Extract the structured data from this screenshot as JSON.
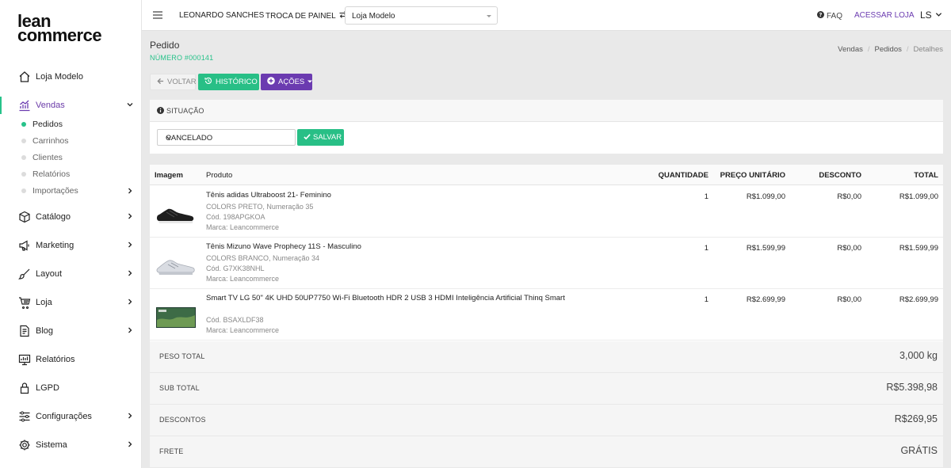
{
  "brand": {
    "logo_line1": "lean",
    "logo_line2": "commerce",
    "accent_green": "#27c28a",
    "accent_purple": "#6b3bb0"
  },
  "topbar": {
    "user_name": "LEONARDO SANCHES",
    "switch_panel": "TROCA DE PAINEL",
    "store": "Loja Modelo",
    "faq": "FAQ",
    "access_store": "ACESSAR LOJA",
    "avatar_initials": "LS"
  },
  "sidebar": {
    "items": [
      {
        "label": "Loja Modelo",
        "icon": "house-icon"
      },
      {
        "label": "Vendas",
        "icon": "chart-icon"
      },
      {
        "label": "Catálogo",
        "icon": "box-icon"
      },
      {
        "label": "Marketing",
        "icon": "megaphone-icon"
      },
      {
        "label": "Layout",
        "icon": "brush-icon"
      },
      {
        "label": "Loja",
        "icon": "cart-icon"
      },
      {
        "label": "Blog",
        "icon": "document-icon"
      },
      {
        "label": "Relatórios",
        "icon": "monitor-chart-icon"
      },
      {
        "label": "LGPD",
        "icon": "lock-icon"
      },
      {
        "label": "Configurações",
        "icon": "sliders-icon"
      },
      {
        "label": "Sistema",
        "icon": "gear-icon"
      }
    ],
    "sales_sub": [
      "Pedidos",
      "Carrinhos",
      "Clientes",
      "Relatórios",
      "Importações"
    ]
  },
  "page": {
    "title": "Pedido",
    "order_number": "NÚMERO #000141",
    "breadcrumb": [
      "Vendas",
      "Pedidos",
      "Detalhes"
    ]
  },
  "actions": {
    "back": "VOLTAR",
    "history": "HISTÓRICO",
    "actions": "AÇÕES"
  },
  "situation": {
    "header": "SITUAÇÃO",
    "status": "CANCELADO",
    "save": "SALVAR"
  },
  "table": {
    "headers": [
      "Imagem",
      "Produto",
      "QUANTIDADE",
      "PREÇO UNITÁRIO",
      "DESCONTO",
      "TOTAL"
    ],
    "rows": [
      {
        "name": "Tênis adidas Ultraboost 21- Feminino",
        "variant": "COLORS PRETO, Numeração 35",
        "sku": "Cód. 198APGKOA",
        "brand": "Marca: Leancommerce",
        "qty": "1",
        "unit_price": "R$1.099,00",
        "discount": "R$0,00",
        "total": "R$1.099,00",
        "image": "black-sneaker-image"
      },
      {
        "name": "Tênis Mizuno Wave Prophecy 11S - Masculino",
        "variant": "COLORS BRANCO, Numeração 34",
        "sku": "Cód. G7XK38NHL",
        "brand": "Marca: Leancommerce",
        "qty": "1",
        "unit_price": "R$1.599,99",
        "discount": "R$0,00",
        "total": "R$1.599,99",
        "image": "white-sneaker-image"
      },
      {
        "name": "Smart TV LG 50\" 4K UHD 50UP7750 Wi-Fi Bluetooth HDR 2 USB 3 HDMI Inteligência Artificial Thinq Smart",
        "variant": "",
        "sku": "Cód. BSAXLDF38",
        "brand": "Marca: Leancommerce",
        "qty": "1",
        "unit_price": "R$2.699,99",
        "discount": "R$0,00",
        "total": "R$2.699,99",
        "image": "tv-image"
      }
    ]
  },
  "summary": {
    "weight_label": "PESO TOTAL",
    "weight": "3,000 kg",
    "subtotal_label": "SUB TOTAL",
    "subtotal": "R$5.398,98",
    "discounts_label": "DESCONTOS",
    "discounts": "R$269,95",
    "shipping_label": "FRETE",
    "shipping": "GRÁTIS"
  }
}
